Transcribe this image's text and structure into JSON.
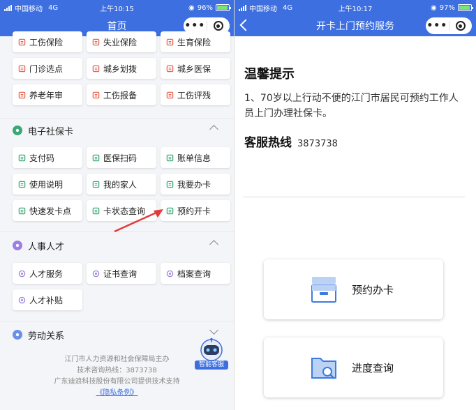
{
  "left": {
    "statusbar": {
      "carrier": "中国移动",
      "network": "4G",
      "time": "上午10:15",
      "battery": "96%"
    },
    "navbar": {
      "title": "首页",
      "more": "•••"
    },
    "top_rows": [
      [
        {
          "label": "工伤保险",
          "icon": "injury-icon",
          "color": "#e8614f"
        },
        {
          "label": "失业保险",
          "icon": "unemployment-icon",
          "color": "#e8614f"
        },
        {
          "label": "生育保险",
          "icon": "maternity-icon",
          "color": "#e8614f"
        }
      ],
      [
        {
          "label": "门诊选点",
          "icon": "clinic-icon",
          "color": "#e8614f"
        },
        {
          "label": "城乡划拨",
          "icon": "transfer-icon",
          "color": "#e8614f"
        },
        {
          "label": "城乡医保",
          "icon": "medical-icon",
          "color": "#e8614f"
        }
      ],
      [
        {
          "label": "养老年审",
          "icon": "pension-icon",
          "color": "#e8614f"
        },
        {
          "label": "工伤报备",
          "icon": "report-icon",
          "color": "#e8614f"
        },
        {
          "label": "工伤评残",
          "icon": "disability-icon",
          "color": "#e8614f"
        }
      ]
    ],
    "social_card": {
      "title": "电子社保卡",
      "rows": [
        [
          {
            "label": "支付码"
          },
          {
            "label": "医保扫码"
          },
          {
            "label": "账单信息"
          }
        ],
        [
          {
            "label": "使用说明"
          },
          {
            "label": "我的家人"
          },
          {
            "label": "我要办卡"
          }
        ],
        [
          {
            "label": "快速发卡点"
          },
          {
            "label": "卡状态查询"
          },
          {
            "label": "预约开卡"
          }
        ]
      ]
    },
    "talent": {
      "title": "人事人才",
      "rows": [
        [
          {
            "label": "人才服务"
          },
          {
            "label": "证书查询"
          },
          {
            "label": "档案查询"
          }
        ],
        [
          {
            "label": "人才补贴"
          }
        ]
      ]
    },
    "labor": {
      "title": "劳动关系"
    },
    "footer": {
      "line1": "江门市人力资源和社会保障局主办",
      "line2": "技术咨询热线：3873738",
      "line3": "广东迪浪科技股份有限公司提供技术支持",
      "privacy": "《隐私条例》"
    },
    "robot_label": "智能客服"
  },
  "right": {
    "statusbar": {
      "carrier": "中国移动",
      "network": "4G",
      "time": "上午10:17",
      "battery": "97%"
    },
    "navbar": {
      "title": "开卡上门预约服务",
      "more": "•••"
    },
    "tips_title": "温馨提示",
    "tips_body": "1、70岁以上行动不便的江门市居民可预约工作人员上门办理社保卡。",
    "hotline_label": "客服热线",
    "hotline_value": "3873738",
    "btn_book": "预约办卡",
    "btn_progress": "进度查询"
  },
  "colors": {
    "brand": "#3d6fe0",
    "accent_red": "#e8614f",
    "accent_green": "#3aa876",
    "arrow": "#e23b3b"
  }
}
